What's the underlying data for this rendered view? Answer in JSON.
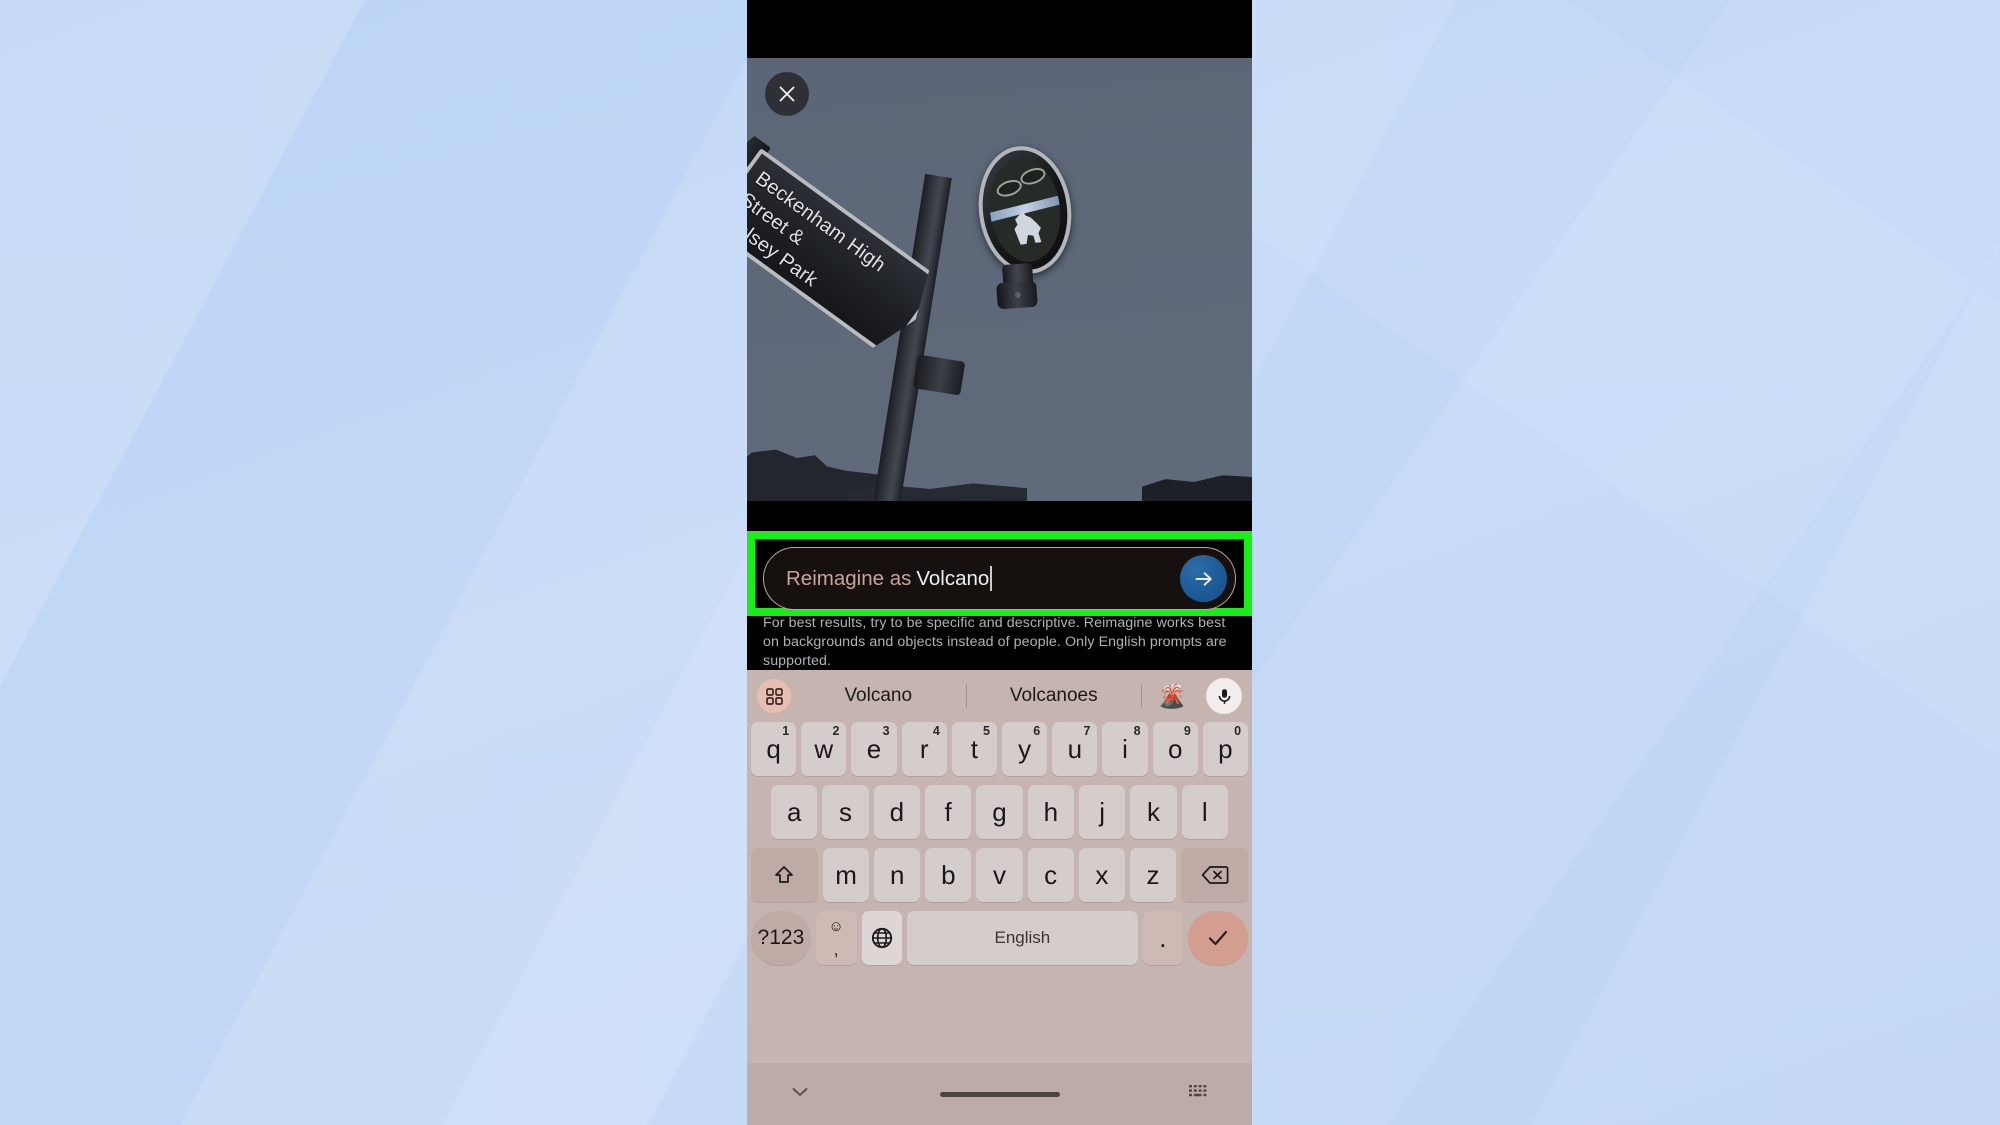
{
  "app": {
    "name": "Google Photos Reimagine",
    "accent_green": "#18ef18",
    "send_button_color": "#1f5e9c",
    "keyboard_bg": "#c5b4b0"
  },
  "photo": {
    "close_icon": "close-icon",
    "alt": "Street signpost against grey sky",
    "sign_line_1": "Beckenham High Street &",
    "sign_line_2": "Kelsey Park",
    "crest_label": "borough crest emblem"
  },
  "prompt": {
    "prefix_label": "Reimagine as",
    "value": "Volcano",
    "placeholder": "Reimagine as",
    "send_icon": "arrow-right-icon",
    "helper_text": "For best results, try to be specific and descriptive. Reimagine works best on backgrounds and objects instead of people. Only English prompts are supported."
  },
  "keyboard": {
    "toolbar": {
      "grid_icon": "grid-apps-icon",
      "suggestions": [
        "Volcano",
        "Volcanoes"
      ],
      "emoji": "🌋",
      "mic_icon": "microphone-icon"
    },
    "row1": [
      {
        "key": "q",
        "num": "1"
      },
      {
        "key": "w",
        "num": "2"
      },
      {
        "key": "e",
        "num": "3"
      },
      {
        "key": "r",
        "num": "4"
      },
      {
        "key": "t",
        "num": "5"
      },
      {
        "key": "y",
        "num": "6"
      },
      {
        "key": "u",
        "num": "7"
      },
      {
        "key": "i",
        "num": "8"
      },
      {
        "key": "o",
        "num": "9"
      },
      {
        "key": "p",
        "num": "0"
      }
    ],
    "row2": [
      "a",
      "s",
      "d",
      "f",
      "g",
      "h",
      "j",
      "k",
      "l"
    ],
    "row3": [
      "z",
      "x",
      "c",
      "v",
      "b",
      "n",
      "m"
    ],
    "shift_icon": "shift-arrow-icon",
    "backspace_icon": "backspace-icon",
    "row4": {
      "symbols_label": "?123",
      "emoji_icon": "emoji-smiley-icon",
      "comma_label": ",",
      "globe_icon": "globe-language-icon",
      "space_label": "English",
      "period_label": ".",
      "enter_icon": "checkmark-icon"
    }
  },
  "navbar": {
    "hide_keyboard_icon": "chevron-down-icon",
    "home_indicator": "home-indicator",
    "switch_keyboard_icon": "keyboard-switch-icon"
  }
}
